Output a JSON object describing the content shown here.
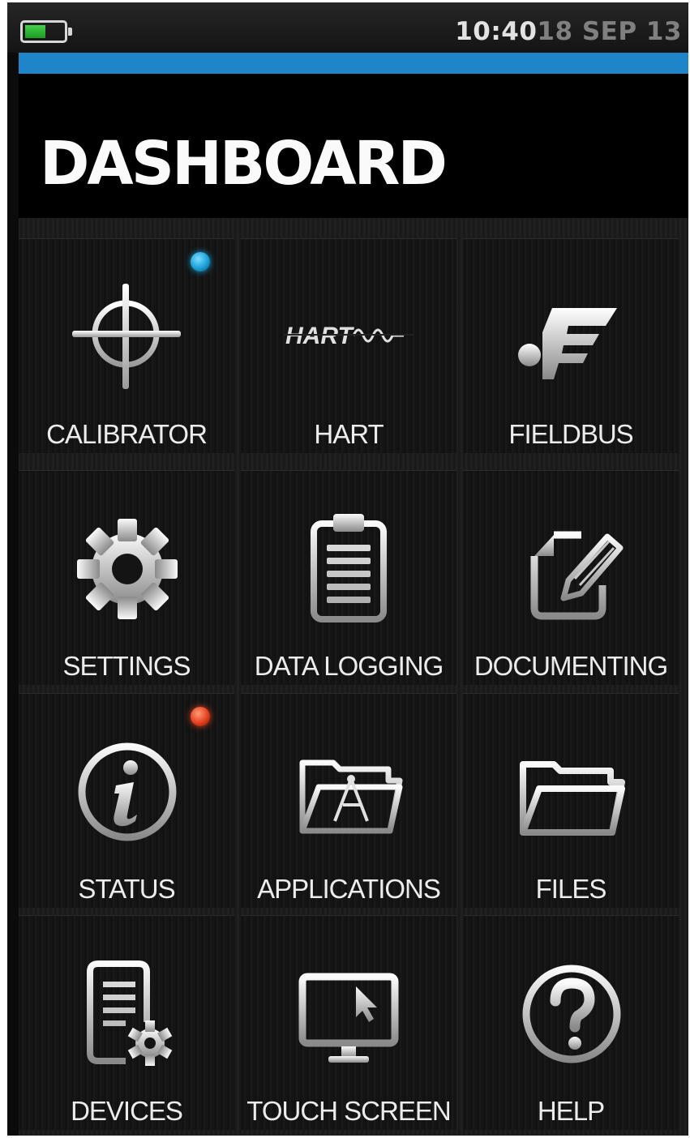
{
  "status_bar": {
    "time": "10:40",
    "date": "18 SEP 13",
    "battery_level": 0.55
  },
  "header": {
    "title": "DASHBOARD"
  },
  "colors": {
    "accent": "#1e85c9",
    "indicator_blue": "#1aa0d8",
    "indicator_red": "#e5401c",
    "battery_green": "#2bb832"
  },
  "tiles": [
    {
      "label": "CALIBRATOR",
      "icon": "crosshair-icon",
      "indicator": "blue-indicator"
    },
    {
      "label": "HART",
      "icon": "hart-logo-icon",
      "icon_text": "HART"
    },
    {
      "label": "FIELDBUS",
      "icon": "fieldbus-icon"
    },
    {
      "label": "SETTINGS",
      "icon": "gear-icon"
    },
    {
      "label": "DATA LOGGING",
      "icon": "clipboard-icon"
    },
    {
      "label": "DOCUMENTING",
      "icon": "document-pencil-icon"
    },
    {
      "label": "STATUS",
      "icon": "info-icon",
      "indicator": "red-indicator"
    },
    {
      "label": "APPLICATIONS",
      "icon": "folder-compass-icon"
    },
    {
      "label": "FILES",
      "icon": "folder-icon"
    },
    {
      "label": "DEVICES",
      "icon": "document-gear-icon"
    },
    {
      "label": "TOUCH SCREEN",
      "icon": "monitor-cursor-icon"
    },
    {
      "label": "HELP",
      "icon": "help-icon"
    }
  ]
}
